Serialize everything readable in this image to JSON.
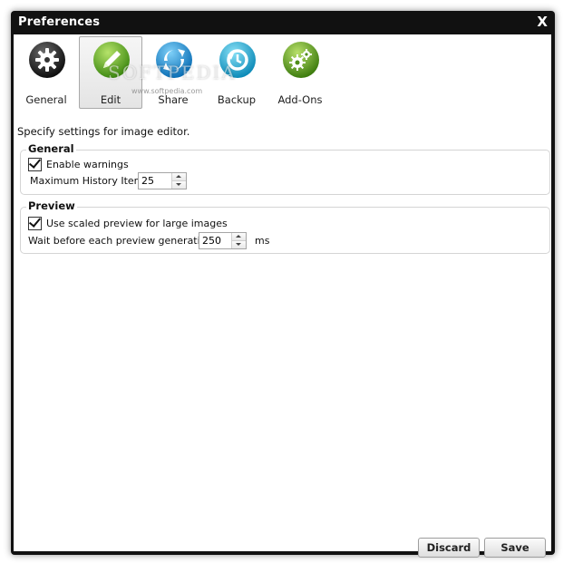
{
  "window": {
    "title": "Preferences",
    "close_label": "X"
  },
  "toolbar": {
    "items": [
      {
        "label": "General",
        "icon": "gear-icon",
        "color": "#2a2a2a",
        "selected": false
      },
      {
        "label": "Edit",
        "icon": "edit-icon",
        "color": "#6bb82c",
        "selected": true
      },
      {
        "label": "Share",
        "icon": "share-icon",
        "color": "#1f93d6",
        "selected": false
      },
      {
        "label": "Backup",
        "icon": "backup-icon",
        "color": "#1faed6",
        "selected": false
      },
      {
        "label": "Add-Ons",
        "icon": "addons-icon",
        "color": "#6aaa24",
        "selected": false
      }
    ]
  },
  "watermark": {
    "text": "SOFTPEDIA",
    "url": "www.softpedia.com"
  },
  "description": "Specify settings for image editor.",
  "general_group": {
    "legend": "General",
    "enable_warnings_label": "Enable warnings",
    "enable_warnings_checked": true,
    "max_history_label": "Maximum History Items:",
    "max_history_value": "25"
  },
  "preview_group": {
    "legend": "Preview",
    "scaled_preview_label": "Use scaled preview for large images",
    "scaled_preview_checked": true,
    "wait_label": "Wait before each preview generation",
    "wait_value": "250",
    "wait_unit": "ms"
  },
  "footer": {
    "discard_label": "Discard",
    "save_label": "Save"
  }
}
